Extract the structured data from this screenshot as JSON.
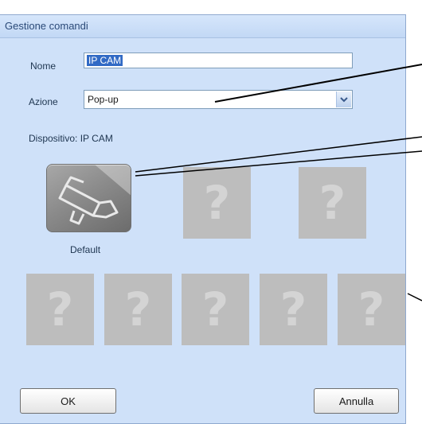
{
  "window": {
    "title": "Gestione comandi"
  },
  "form": {
    "name_label": "Nome",
    "name_value": "IP CAM",
    "action_label": "Azione",
    "action_value": "Pop-up",
    "device_label": "Dispositivo: IP CAM"
  },
  "icons": {
    "selected": {
      "name": "camera-icon",
      "caption": "Default"
    },
    "placeholder_glyph": "?"
  },
  "buttons": {
    "ok": "OK",
    "cancel": "Annulla"
  },
  "colors": {
    "dialog_bg": "#cfe1f9",
    "placeholder_tile": "#bdbdbd",
    "selection": "#316ac5"
  }
}
